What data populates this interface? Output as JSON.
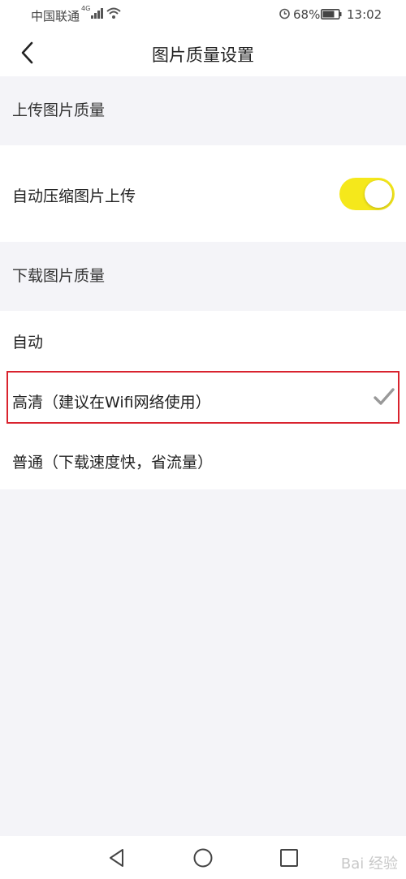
{
  "status_bar": {
    "carrier": "中国联通",
    "network": "4G",
    "battery_percent": "68%",
    "time": "13:02",
    "icons": [
      "signal-icon",
      "wifi-icon",
      "alarm-icon",
      "battery-icon"
    ]
  },
  "header": {
    "title": "图片质量设置",
    "back_icon": "chevron-left-icon"
  },
  "upload_section": {
    "header": "上传图片质量",
    "auto_compress_label": "自动压缩图片上传",
    "auto_compress_enabled": true
  },
  "download_section": {
    "header": "下载图片质量",
    "options": [
      {
        "label": "自动",
        "selected": false
      },
      {
        "label": "高清（建议在Wifi网络使用）",
        "selected": true
      },
      {
        "label": "普通（下载速度快，省流量）",
        "selected": false
      }
    ]
  },
  "bottom_nav": {
    "icons": [
      "back-triangle-icon",
      "home-circle-icon",
      "recents-square-icon"
    ]
  },
  "watermark": "Bai 经验",
  "colors": {
    "toggle_on": "#f5e81b",
    "highlight_border": "#d9232e",
    "background": "#f4f4f8",
    "check": "#999999"
  }
}
